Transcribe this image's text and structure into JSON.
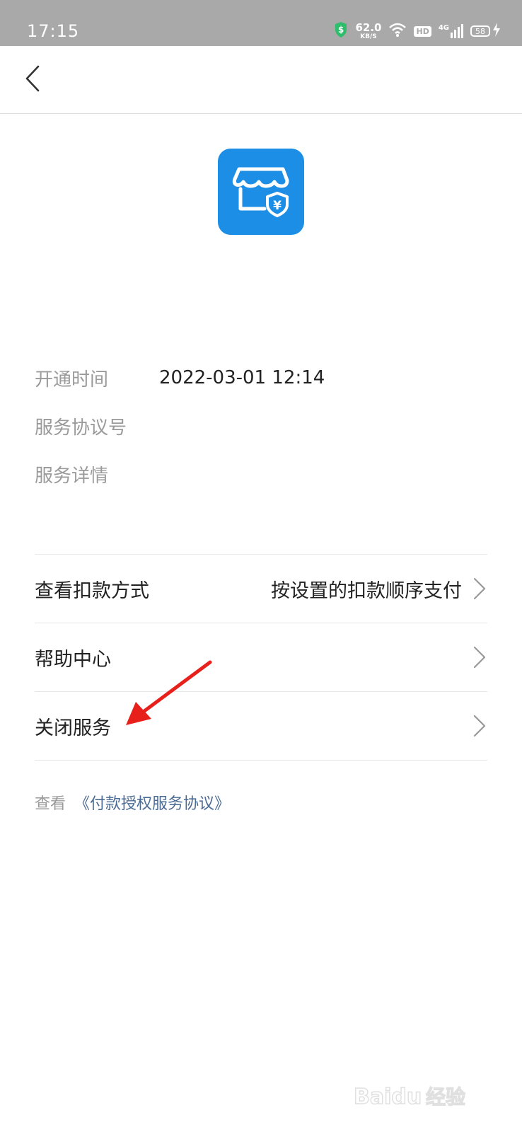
{
  "status_bar": {
    "time": "17:15",
    "net_speed_value": "62.0",
    "net_speed_unit": "KB/S",
    "hd_label": "HD",
    "network_label": "4G",
    "battery_level": "58",
    "icons": [
      "shield-dollar-icon",
      "wifi-icon",
      "signal-icon",
      "charging-icon"
    ]
  },
  "nav": {
    "back_icon": "chevron-left-icon"
  },
  "app": {
    "icon": "store-shield-yuan-icon",
    "icon_color": "#1c8ee6"
  },
  "info": {
    "rows": [
      {
        "label": "开通时间",
        "value": "2022-03-01 12:14"
      },
      {
        "label": "服务协议号",
        "value": ""
      },
      {
        "label": "服务详情",
        "value": ""
      }
    ]
  },
  "list": {
    "items": [
      {
        "label": "查看扣款方式",
        "value": "按设置的扣款顺序支付"
      },
      {
        "label": "帮助中心",
        "value": ""
      },
      {
        "label": "关闭服务",
        "value": ""
      }
    ]
  },
  "agreement": {
    "prefix": "查看",
    "link": "《付款授权服务协议》",
    "link_color": "#4a6b94"
  },
  "watermark": {
    "text": "Baidu经验"
  }
}
